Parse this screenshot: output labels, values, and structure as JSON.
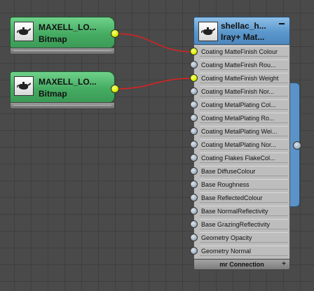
{
  "bitmap_nodes": [
    {
      "title": "MAXELL_LO...",
      "subtitle": "Bitmap",
      "icon": "teapot-icon",
      "port_color": "#d6f000"
    },
    {
      "title": "MAXELL_LO...",
      "subtitle": "Bitmap",
      "icon": "teapot-icon",
      "port_color": "#d6f000"
    }
  ],
  "material_node": {
    "title": "shellac_h...",
    "subtitle": "Iray+ Mat...",
    "icon": "teapot-icon",
    "collapse_label": "−",
    "footer_label": "mr Connection",
    "footer_expand": "+",
    "slots": [
      {
        "label": "Coating MatteFinish Colour",
        "connected": true
      },
      {
        "label": "Coating MatteFinish Rou...",
        "connected": false
      },
      {
        "label": "Coating MatteFinish Weight",
        "connected": true
      },
      {
        "label": "Coating MatteFinish Nor...",
        "connected": false
      },
      {
        "label": "Coating MetalPlating Col...",
        "connected": false
      },
      {
        "label": "Coating MetalPlating Ro...",
        "connected": false
      },
      {
        "label": "Coating MetalPlating Wei...",
        "connected": false
      },
      {
        "label": "Coating MetalPlating Nor...",
        "connected": false
      },
      {
        "label": "Coating Flakes FlakeCol...",
        "connected": false
      },
      {
        "label": "Base DiffuseColour",
        "connected": false
      },
      {
        "label": "Base Roughness",
        "connected": false
      },
      {
        "label": "Base ReflectedColour",
        "connected": false
      },
      {
        "label": "Base NormalReflectivity",
        "connected": false
      },
      {
        "label": "Base GrazingReflectivity",
        "connected": false
      },
      {
        "label": "Geometry Opacity",
        "connected": false
      },
      {
        "label": "Geometry Normal",
        "connected": false
      }
    ]
  },
  "colors": {
    "wire": "#e02020",
    "bitmap_node": "#45ab62",
    "material_header": "#5b97cc",
    "connected_port": "#d6f000",
    "canvas": "#4a4a4a"
  }
}
